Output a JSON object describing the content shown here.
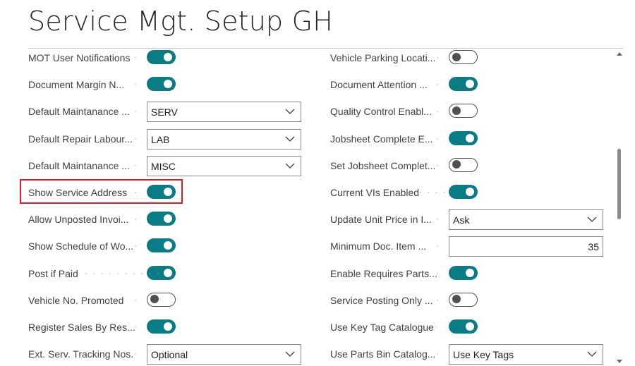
{
  "page": {
    "title": "Service Mgt. Setup GH"
  },
  "left_fields": [
    {
      "label": "MOT User Notifications",
      "type": "toggle",
      "on": true
    },
    {
      "label": "Document Margin N...",
      "type": "toggle",
      "on": true
    },
    {
      "label": "Default Maintanance ...",
      "type": "select",
      "value": "SERV"
    },
    {
      "label": "Default Repair Labour...",
      "type": "select",
      "value": "LAB"
    },
    {
      "label": "Default Maintanance ...",
      "type": "select",
      "value": "MISC"
    },
    {
      "label": "Show Service Address",
      "type": "toggle",
      "on": true
    },
    {
      "label": "Allow Unposted Invoi...",
      "type": "toggle",
      "on": true
    },
    {
      "label": "Show Schedule of Wo...",
      "type": "toggle",
      "on": true
    },
    {
      "label": "Post if Paid",
      "type": "toggle",
      "on": true
    },
    {
      "label": "Vehicle No. Promoted",
      "type": "toggle",
      "on": false
    },
    {
      "label": "Register Sales By Res...",
      "type": "toggle",
      "on": true
    },
    {
      "label": "Ext. Serv. Tracking Nos.",
      "type": "select",
      "value": "Optional"
    }
  ],
  "right_fields": [
    {
      "label": "Vehicle Parking Locati...",
      "type": "toggle",
      "on": false
    },
    {
      "label": "Document Attention ...",
      "type": "toggle",
      "on": true
    },
    {
      "label": "Quality Control Enabl...",
      "type": "toggle",
      "on": false
    },
    {
      "label": "Jobsheet Complete E...",
      "type": "toggle",
      "on": true
    },
    {
      "label": "Set Jobsheet Complet...",
      "type": "toggle",
      "on": false
    },
    {
      "label": "Current VIs Enabled",
      "type": "toggle",
      "on": true
    },
    {
      "label": "Update Unit Price in I...",
      "type": "select",
      "value": "Ask"
    },
    {
      "label": "Minimum Doc. Item ...",
      "type": "number",
      "value": "35"
    },
    {
      "label": "Enable Requires Parts...",
      "type": "toggle",
      "on": true
    },
    {
      "label": "Service Posting Only ...",
      "type": "toggle",
      "on": false
    },
    {
      "label": "Use Key Tag Catalogue",
      "type": "toggle",
      "on": true
    },
    {
      "label": "Use Parts Bin Catalog...",
      "type": "select",
      "value": "Use Key Tags"
    }
  ],
  "colors": {
    "accent": "#0a7c86",
    "highlight": "#d9202a"
  }
}
